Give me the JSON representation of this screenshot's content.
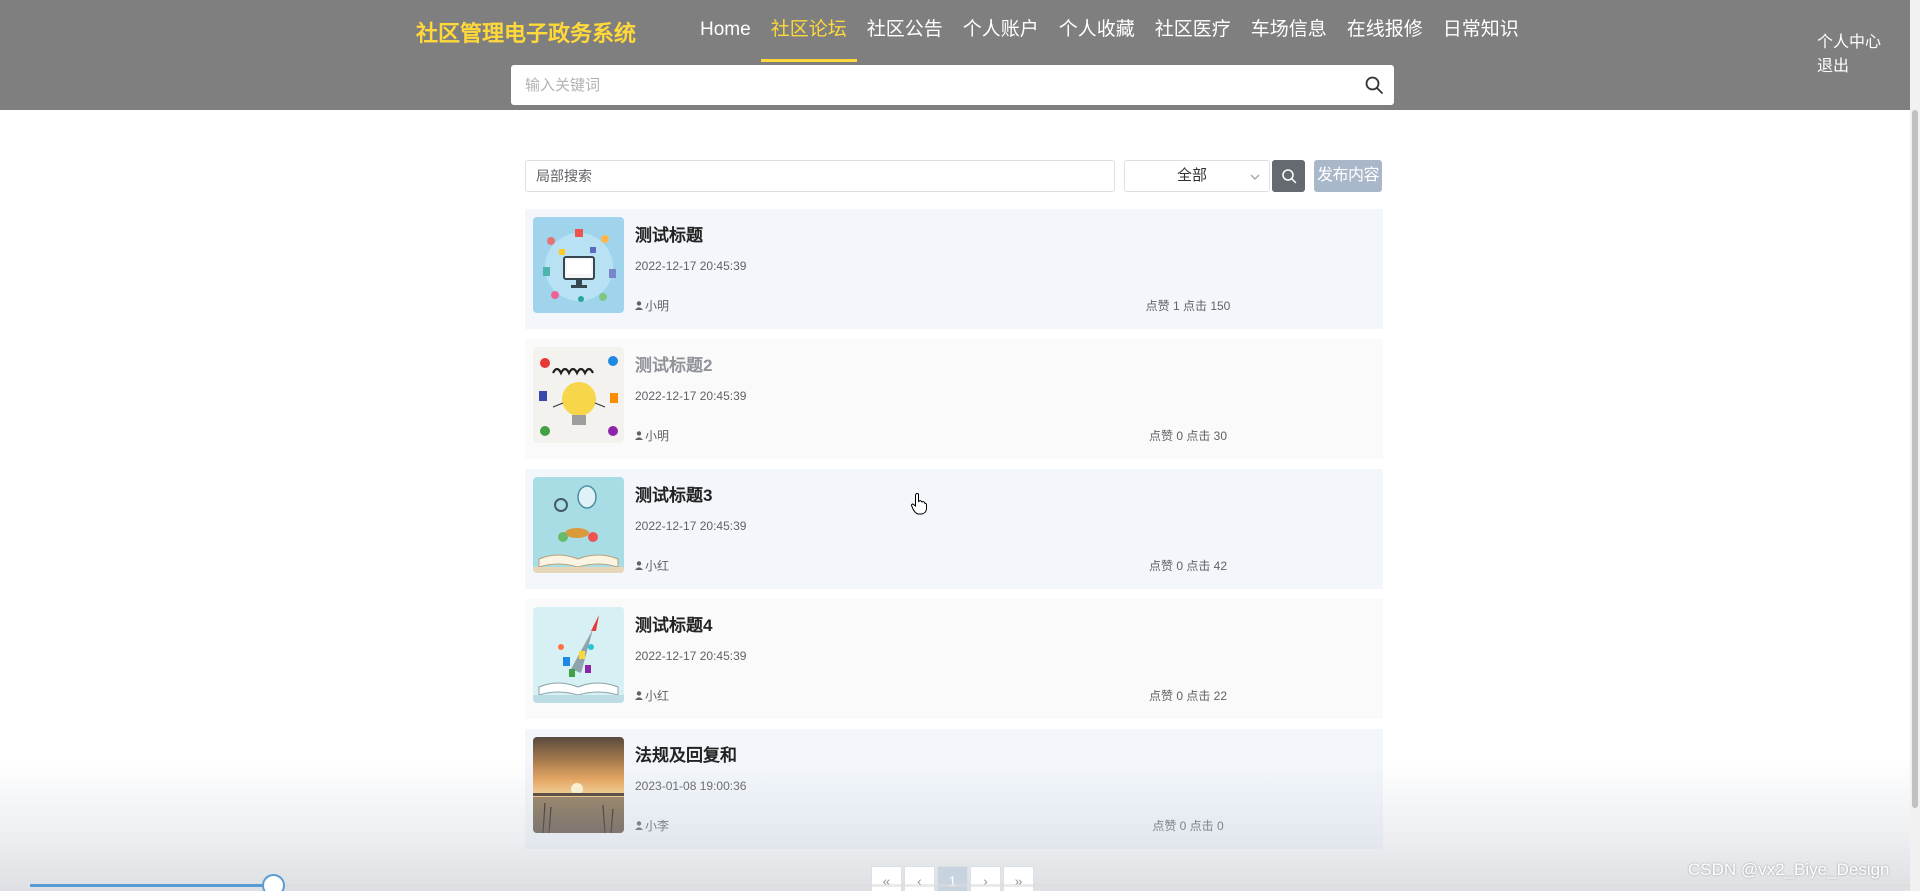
{
  "header": {
    "logo": "社区管理电子政务系统",
    "nav": [
      {
        "label": "Home",
        "active": false
      },
      {
        "label": "社区论坛",
        "active": true
      },
      {
        "label": "社区公告",
        "active": false
      },
      {
        "label": "个人账户",
        "active": false
      },
      {
        "label": "个人收藏",
        "active": false
      },
      {
        "label": "社区医疗",
        "active": false
      },
      {
        "label": "车场信息",
        "active": false
      },
      {
        "label": "在线报修",
        "active": false
      },
      {
        "label": "日常知识",
        "active": false
      }
    ],
    "user_links": {
      "profile": "个人中心",
      "logout": "退出"
    },
    "search_placeholder": "输入关键词"
  },
  "filter": {
    "search_placeholder": "局部搜索",
    "category_selected": "全部",
    "publish_label": "发布内容"
  },
  "posts": [
    {
      "title": "测试标题",
      "time": "2022-12-17 20:45:39",
      "author": "小明",
      "stats": "点赞 1 点击 150",
      "image": "computer-illustration"
    },
    {
      "title": "测试标题2",
      "time": "2022-12-17 20:45:39",
      "author": "小明",
      "stats": "点赞 0 点击 30",
      "image": "learn-lightbulb"
    },
    {
      "title": "测试标题3",
      "time": "2022-12-17 20:45:39",
      "author": "小红",
      "stats": "点赞 0 点击 42",
      "image": "open-book-balloon"
    },
    {
      "title": "测试标题4",
      "time": "2022-12-17 20:45:39",
      "author": "小红",
      "stats": "点赞 0 点击 22",
      "image": "open-book-rocket"
    },
    {
      "title": "法规及回复和",
      "time": "2023-01-08 19:00:36",
      "author": "小李",
      "stats": "点赞 0 点击 0",
      "image": "sunset-lake"
    }
  ],
  "pagination": {
    "first": "«",
    "prev": "‹",
    "current": "1",
    "next": "›",
    "last": "»"
  },
  "video": {
    "progress": 0.13
  },
  "watermark": "CSDN @vx2_Biye_Design",
  "colors": {
    "header_bg": "#7f7f7f",
    "accent": "#ffd83a",
    "publish_btn": "#a9b7ca",
    "progress": "#5b9bd5"
  }
}
